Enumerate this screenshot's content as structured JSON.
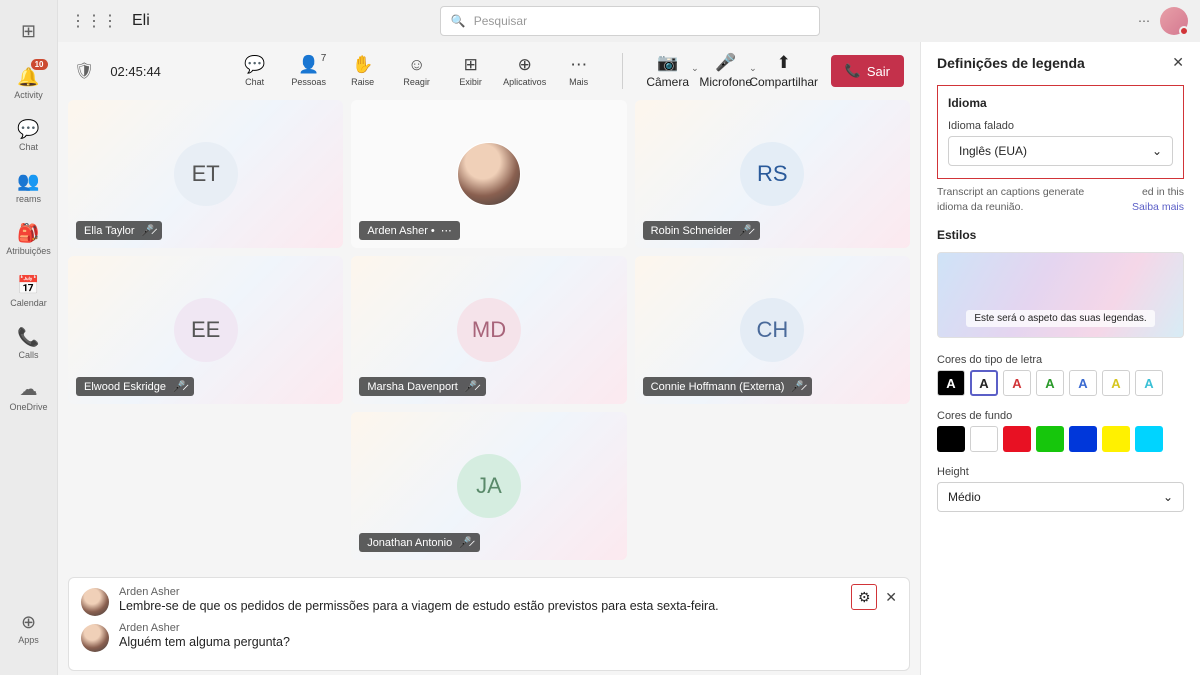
{
  "header": {
    "app_title": "Eli",
    "search_placeholder": "Pesquisar"
  },
  "rail": {
    "items": [
      {
        "label": "Activity",
        "badge": "10"
      },
      {
        "label": "Chat"
      },
      {
        "label": "reams"
      },
      {
        "label": "Atribuições"
      },
      {
        "label": "Calendar"
      },
      {
        "label": "Calls"
      },
      {
        "label": "OneDrive"
      }
    ],
    "apps": "Apps"
  },
  "meeting": {
    "timer": "02:45:44",
    "toolbar": {
      "chat": "Chat",
      "people": "Pessoas",
      "people_count": "7",
      "raise": "Raise",
      "react": "Reagir",
      "view": "Exibir",
      "apps": "Aplicativos",
      "more": "Mais",
      "camera": "Câmera",
      "mic": "Microfone",
      "share": "Compartilhar",
      "leave": "Sair"
    },
    "tiles": [
      {
        "initials": "ET",
        "name": "Ella Taylor",
        "muted": true,
        "bg": "#e8eef5"
      },
      {
        "photo": true,
        "name": "Arden Asher •",
        "muted": false
      },
      {
        "initials": "RS",
        "name": "Robin Schneider",
        "muted": true,
        "bg": "#e4edf6",
        "fg": "#2a5a9a"
      },
      {
        "initials": "EE",
        "name": "Elwood Eskridge",
        "muted": true,
        "bg": "#f0e7f3"
      },
      {
        "initials": "MD",
        "name": "Marsha Davenport",
        "muted": true,
        "bg": "#f5e3ea",
        "fg": "#a8647a"
      },
      {
        "initials": "CH",
        "name": "Connie Hoffmann (Externa)",
        "muted": true,
        "bg": "#e4ecf5",
        "fg": "#4a6a9a"
      },
      {
        "initials": "JA",
        "name": "Jonathan Antonio",
        "muted": true,
        "bg": "#d5ede0",
        "fg": "#5a8a6a"
      }
    ]
  },
  "captions": [
    {
      "name": "Arden Asher",
      "msg": "Lembre-se de que os pedidos de permissões para a viagem de estudo estão previstos para esta sexta-feira."
    },
    {
      "name": "Arden Asher",
      "msg": "Alguém tem alguma pergunta?"
    }
  ],
  "panel": {
    "title": "Definições de legenda",
    "lang_section": "Idioma",
    "spoken_label": "Idioma falado",
    "spoken_value": "Inglês (EUA)",
    "hint_left": "Transcript an captions generate",
    "hint_right": "ed in this",
    "hint2": "idioma da reunião.",
    "learn_more": "Saiba mais",
    "styles": "Estilos",
    "preview_text": "Este será o aspeto das suas legendas.",
    "font_colors": "Cores do tipo de letra",
    "bg_colors": "Cores de fundo",
    "height": "Height",
    "height_value": "Médio",
    "font_swatches": [
      {
        "bg": "#000",
        "fg": "#fff"
      },
      {
        "bg": "#fff",
        "fg": "#242424",
        "sel": true
      },
      {
        "bg": "#fff",
        "fg": "#d13438"
      },
      {
        "bg": "#fff",
        "fg": "#2a9a2a"
      },
      {
        "bg": "#fff",
        "fg": "#3a6ad1"
      },
      {
        "bg": "#fff",
        "fg": "#d6c620"
      },
      {
        "bg": "#fff",
        "fg": "#3ac0d6"
      }
    ],
    "bg_swatches": [
      "#000",
      "#fff",
      "#e81123",
      "#16c60c",
      "#0037da",
      "#fff100",
      "#00d4ff"
    ]
  }
}
